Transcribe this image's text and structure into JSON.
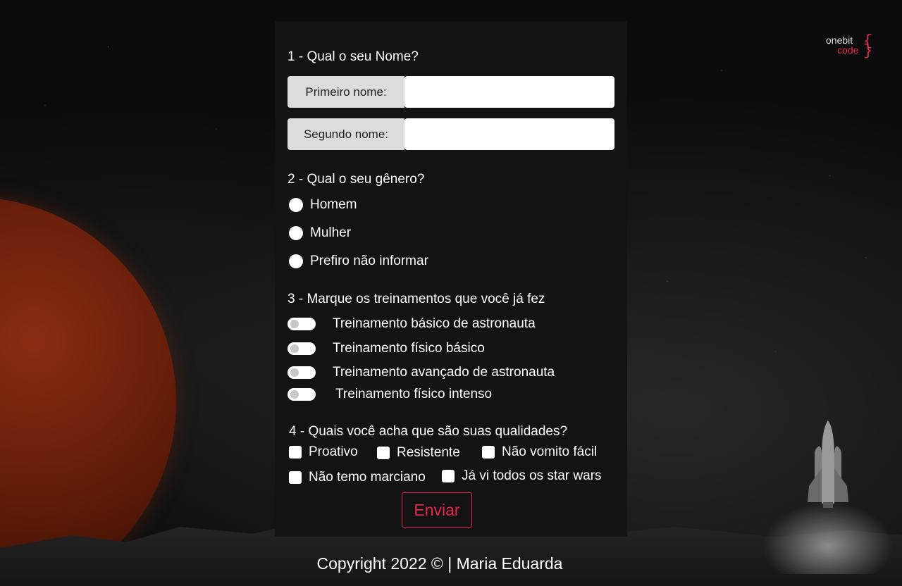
{
  "brand": {
    "line1": "onebit",
    "line2": "code"
  },
  "form": {
    "q1": "1 - Qual o seu Nome?",
    "first_name_label": "Primeiro nome:",
    "last_name_label": "Segundo nome:",
    "first_name_value": "",
    "last_name_value": "",
    "q2": "2 - Qual o seu gênero?",
    "gender_options": [
      "Homem",
      "Mulher",
      "Prefiro não informar"
    ],
    "q3": "3 - Marque os treinamentos que você já fez",
    "trainings": [
      "Treinamento básico de astronauta",
      "Treinamento físico básico",
      "Treinamento avançado de astronauta",
      "Treinamento físico intenso"
    ],
    "q4": "4 - Quais você acha que são suas qualidades?",
    "qualities": [
      "Proativo",
      "Resistente",
      "Não vomito fácil",
      "Não temo marciano",
      "Já vi todos os star wars"
    ],
    "submit_label": "Enviar"
  },
  "footer": {
    "text": "Copyright 2022 © | Maria Eduarda"
  },
  "colors": {
    "accent": "#e5264d",
    "card_bg": "#131313",
    "label_bg": "#dcdcdc"
  }
}
